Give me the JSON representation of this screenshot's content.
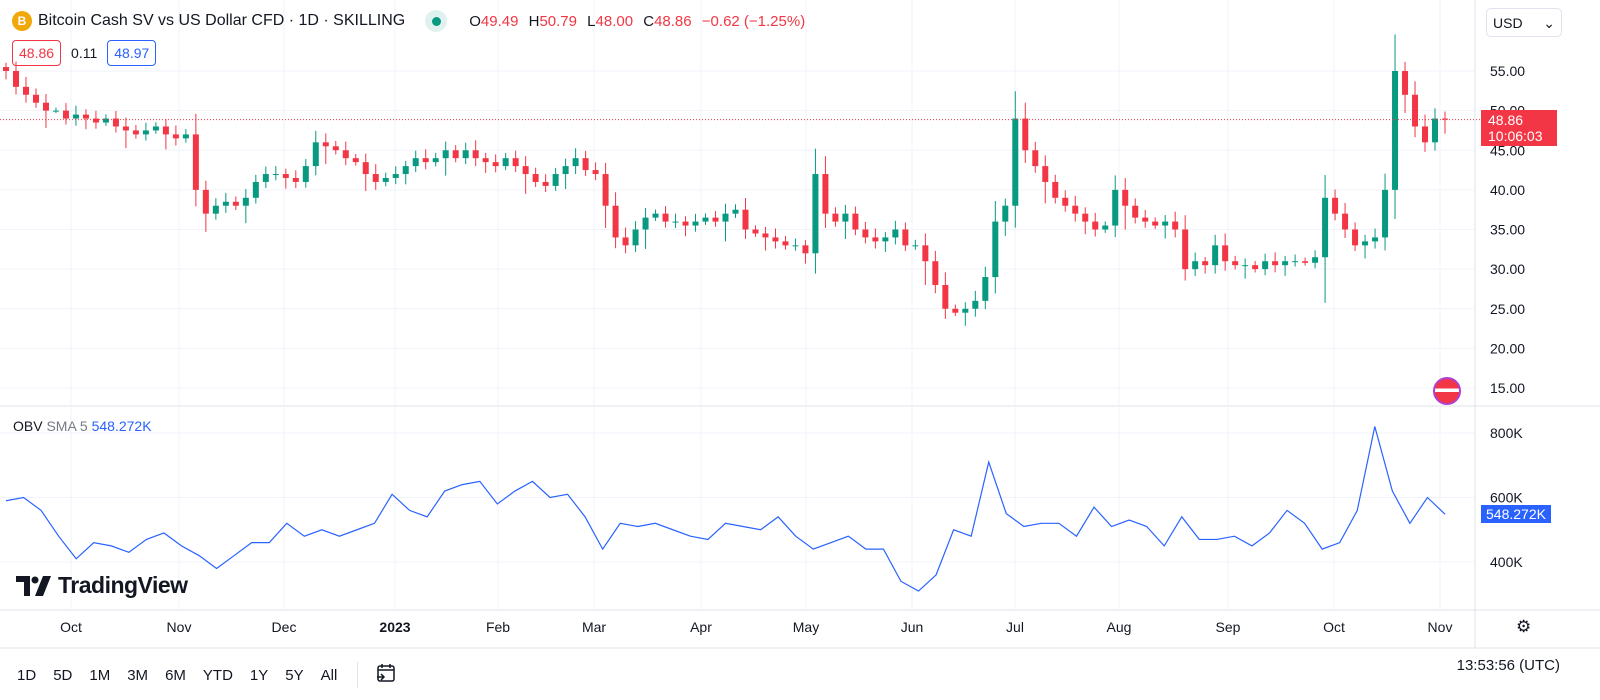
{
  "header": {
    "title": "Bitcoin Cash SV vs US Dollar CFD · 1D · SKILLING",
    "coin_letter": "B",
    "o_label": "O",
    "o": "49.49",
    "h_label": "H",
    "h": "50.79",
    "l_label": "L",
    "l": "48.00",
    "c_label": "C",
    "c": "48.86",
    "change": "−0.62 (−1.25%)"
  },
  "quote": {
    "bid": "48.86",
    "spread": "0.11",
    "ask": "48.97"
  },
  "currency": "USD",
  "last_price_tag": {
    "price": "48.86",
    "countdown": "10:06:03"
  },
  "indicator": {
    "name": "OBV",
    "sma": "SMA 5",
    "value": "548.272K"
  },
  "logo": "TradingView",
  "range_buttons": [
    "1D",
    "5D",
    "1M",
    "3M",
    "6M",
    "YTD",
    "1Y",
    "5Y",
    "All"
  ],
  "clock": "13:53:56 (UTC)",
  "colors": {
    "up": "#089981",
    "down": "#f23645",
    "obv": "#2962ff"
  },
  "chart_data": [
    {
      "type": "candlestick",
      "title": "Bitcoin Cash SV vs US Dollar CFD",
      "interval_days": 3,
      "ylim": [
        13,
        58
      ],
      "yticks": [
        "15.00",
        "20.00",
        "25.00",
        "30.00",
        "35.00",
        "40.00",
        "45.00",
        "50.00",
        "55.00"
      ],
      "xticks": [
        "Oct",
        "Nov",
        "Dec",
        "2023",
        "Feb",
        "Mar",
        "Apr",
        "May",
        "Jun",
        "Jul",
        "Aug",
        "Sep",
        "Oct",
        "Nov"
      ],
      "closes": [
        55,
        53,
        52,
        51,
        50,
        50,
        49,
        49.5,
        49,
        48.5,
        49,
        48,
        47.5,
        47,
        47.5,
        48,
        47,
        46.5,
        47,
        40,
        37,
        38,
        38.5,
        38,
        39,
        41,
        42,
        42,
        41.5,
        41,
        43,
        46,
        45.5,
        45,
        44,
        43.5,
        42,
        41,
        41.5,
        42,
        43,
        44,
        43.5,
        44,
        45,
        44,
        45,
        44,
        43.5,
        43,
        44,
        43,
        42,
        41,
        40.5,
        42,
        43,
        44,
        42.5,
        42,
        38,
        34,
        33,
        35,
        36.5,
        37,
        36,
        36,
        35.5,
        36,
        36.5,
        36,
        37,
        37.5,
        35,
        34.5,
        34,
        33.5,
        33,
        33,
        32,
        42,
        37,
        36,
        37,
        35,
        34,
        33.5,
        34,
        35,
        33,
        33,
        31,
        28,
        25,
        24.5,
        25,
        26,
        29,
        36,
        38,
        49,
        45,
        43,
        41,
        39,
        38,
        37,
        36,
        35,
        35.5,
        40,
        38,
        36.5,
        36,
        35.5,
        36,
        35,
        30,
        31,
        30.5,
        33,
        31,
        30.5,
        30.5,
        30,
        31,
        30.5,
        31,
        31,
        30.8,
        31.5,
        39,
        37,
        35,
        33,
        33.5,
        34,
        40,
        55,
        52,
        48,
        46,
        49,
        48.86
      ],
      "last": 48.86
    },
    {
      "type": "line",
      "name": "OBV SMA 5",
      "ylim": [
        250,
        850
      ],
      "yticks": [
        "400K",
        "600K",
        "800K"
      ],
      "values": [
        590,
        600,
        560,
        480,
        410,
        460,
        450,
        430,
        470,
        490,
        450,
        420,
        380,
        420,
        460,
        460,
        520,
        480,
        500,
        480,
        500,
        520,
        610,
        560,
        540,
        620,
        640,
        650,
        580,
        620,
        650,
        600,
        610,
        540,
        440,
        520,
        510,
        520,
        500,
        480,
        470,
        520,
        510,
        500,
        540,
        480,
        440,
        460,
        480,
        440,
        440,
        340,
        310,
        360,
        500,
        480,
        710,
        550,
        510,
        520,
        520,
        480,
        570,
        510,
        530,
        510,
        450,
        540,
        470,
        470,
        480,
        450,
        490,
        560,
        520,
        440,
        460,
        560,
        820,
        620,
        520,
        600,
        548.272
      ]
    }
  ]
}
